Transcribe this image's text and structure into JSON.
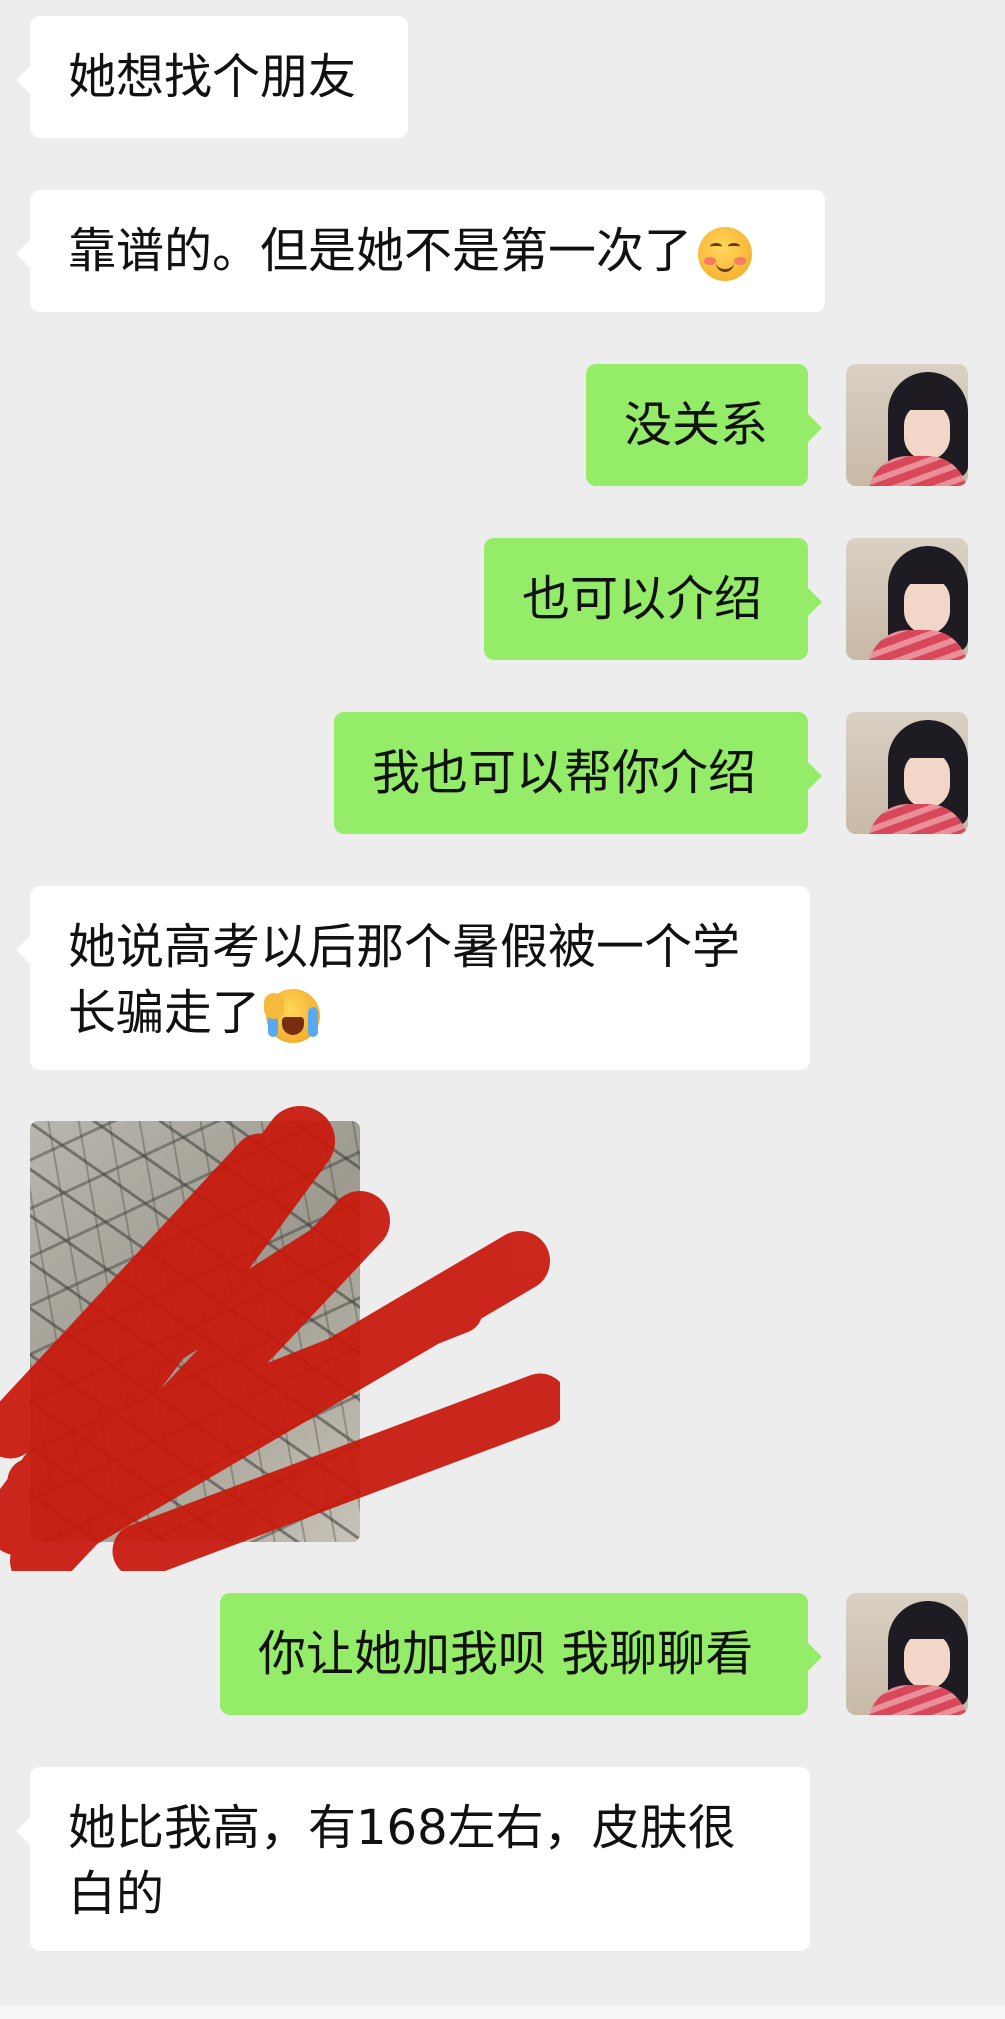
{
  "messages": [
    {
      "side": "in",
      "text": "她想找个朋友"
    },
    {
      "side": "in",
      "text": "靠谱的。但是她不是第一次了",
      "emoji": "blush-smile-emoji"
    },
    {
      "side": "out",
      "text": "没关系"
    },
    {
      "side": "out",
      "text": "也可以介绍"
    },
    {
      "side": "out",
      "text": "我也可以帮你介绍"
    },
    {
      "side": "in",
      "text": "她说高考以后那个暑假被一个学长骗走了",
      "emoji": "laugh-cry-emoji"
    },
    {
      "side": "in",
      "type": "image",
      "image": "redacted-photo-stone-wall"
    },
    {
      "side": "out",
      "text": "你让她加我呗 我聊聊看"
    },
    {
      "side": "in",
      "text": "她比我高，有168左右，皮肤很白的"
    }
  ],
  "colors": {
    "background": "#ededed",
    "incoming_bubble": "#ffffff",
    "outgoing_bubble": "#95ec69",
    "redaction": "#c8180c"
  }
}
